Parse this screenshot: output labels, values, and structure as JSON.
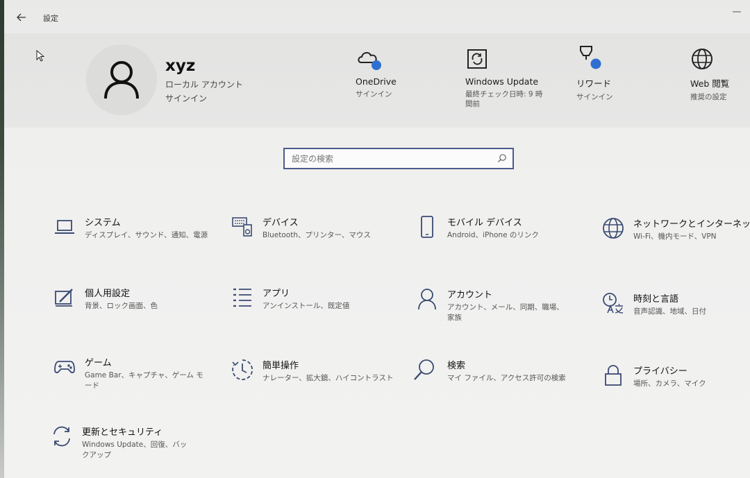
{
  "window": {
    "title": "設定"
  },
  "user": {
    "name": "xyz",
    "account_type": "ローカル アカウント",
    "signin": "サインイン"
  },
  "header_items": [
    {
      "label": "OneDrive",
      "sub": "サインイン",
      "icon": "cloud-icon"
    },
    {
      "label": "Windows Update",
      "sub": "最終チェック日時: 9 時間前",
      "icon": "sync-icon"
    },
    {
      "label": "リワード",
      "sub": "サインイン",
      "icon": "trophy-icon"
    },
    {
      "label": "Web 閲覧",
      "sub": "推奨の設定",
      "icon": "globe-icon"
    }
  ],
  "search": {
    "placeholder": "設定の検索"
  },
  "categories": [
    {
      "title": "システム",
      "desc": "ディスプレイ、サウンド、通知、電源",
      "icon": "laptop-icon"
    },
    {
      "title": "デバイス",
      "desc": "Bluetooth、プリンター、マウス",
      "icon": "keyboard-speaker-icon"
    },
    {
      "title": "モバイル デバイス",
      "desc": "Android、iPhone のリンク",
      "icon": "phone-icon"
    },
    {
      "title": "ネットワークとインターネット",
      "desc": "Wi-Fi、機内モード、VPN",
      "icon": "globe-icon"
    },
    {
      "title": "個人用設定",
      "desc": "背景、ロック画面、色",
      "icon": "paint-icon"
    },
    {
      "title": "アプリ",
      "desc": "アンインストール、既定値",
      "icon": "apps-list-icon"
    },
    {
      "title": "アカウント",
      "desc": "アカウント、メール、同期、職場、家族",
      "icon": "person-icon"
    },
    {
      "title": "時刻と言語",
      "desc": "音声認識、地域、日付",
      "icon": "time-language-icon"
    },
    {
      "title": "ゲーム",
      "desc": "Game Bar、キャプチャ、ゲーム モード",
      "icon": "gamepad-icon"
    },
    {
      "title": "簡単操作",
      "desc": "ナレーター、拡大鏡、ハイコントラスト",
      "icon": "ease-of-access-icon"
    },
    {
      "title": "検索",
      "desc": "マイ ファイル、アクセス許可の検索",
      "icon": "search-icon"
    },
    {
      "title": "プライバシー",
      "desc": "場所、カメラ、マイク",
      "icon": "lock-icon"
    },
    {
      "title": "更新とセキュリティ",
      "desc": "Windows Update、回復、バックアップ",
      "icon": "update-icon"
    }
  ]
}
